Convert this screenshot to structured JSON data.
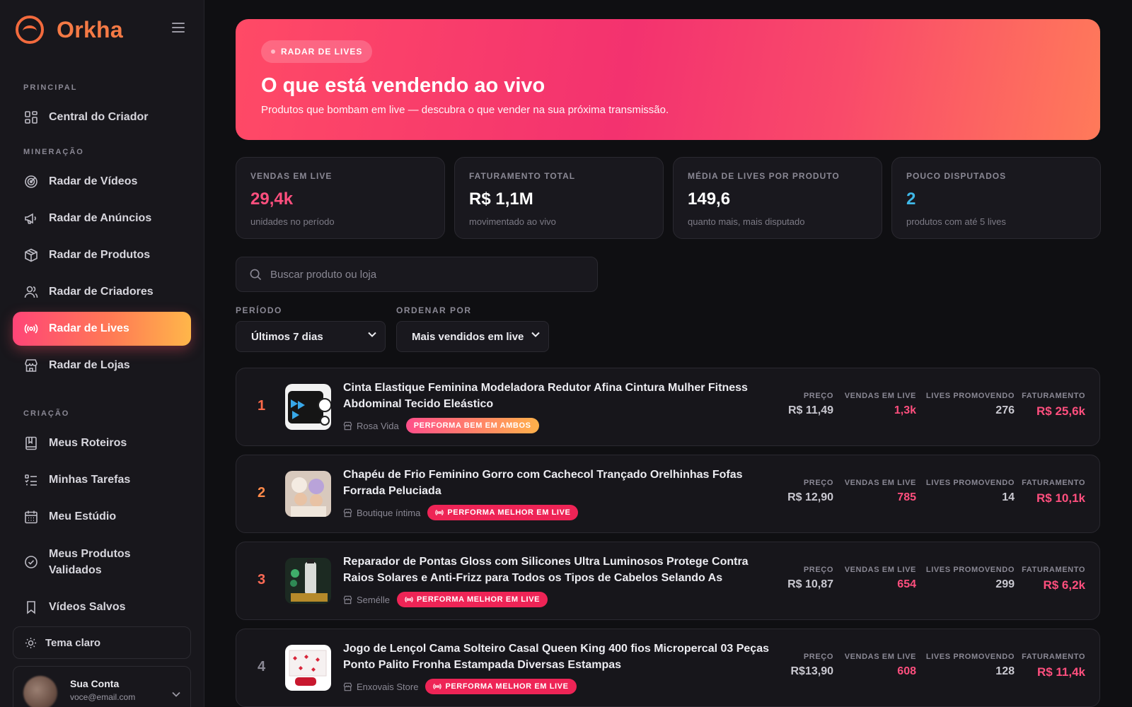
{
  "app": {
    "name": "Orkha"
  },
  "sidebar": {
    "sections": [
      {
        "label": "PRINCIPAL"
      },
      {
        "label": "MINERAÇÃO"
      },
      {
        "label": "CRIAÇÃO"
      }
    ],
    "items": [
      {
        "label": "Central do Criador",
        "icon": "grid-icon"
      },
      {
        "label": "Radar de Vídeos",
        "icon": "radar-icon"
      },
      {
        "label": "Radar de Anúncios",
        "icon": "megaphone-icon"
      },
      {
        "label": "Radar de Produtos",
        "icon": "box-icon"
      },
      {
        "label": "Radar de Criadores",
        "icon": "users-icon"
      },
      {
        "label": "Radar de Lives",
        "icon": "broadcast-icon",
        "active": true
      },
      {
        "label": "Radar de Lojas",
        "icon": "store-icon"
      },
      {
        "label": "Meus Roteiros",
        "icon": "book-icon"
      },
      {
        "label": "Minhas Tarefas",
        "icon": "list-icon"
      },
      {
        "label": "Meu Estúdio",
        "icon": "calendar-icon"
      },
      {
        "label": "Meus Produtos Validados",
        "icon": "check-circle-icon"
      },
      {
        "label": "Vídeos Salvos",
        "icon": "bookmark-icon"
      }
    ],
    "theme_toggle": "Tema claro",
    "account": {
      "name": "Sua Conta",
      "email": "voce@email.com"
    }
  },
  "hero": {
    "badge": "RADAR DE LIVES",
    "title": "O que está vendendo ao vivo",
    "subtitle": "Produtos que bombam em live — descubra o que vender na sua próxima transmissão."
  },
  "stats": [
    {
      "label": "VENDAS EM LIVE",
      "value": "29,4k",
      "note": "unidades no período",
      "color": "#ff4f7e"
    },
    {
      "label": "FATURAMENTO TOTAL",
      "value": "R$ 1,1M",
      "note": "movimentado ao vivo",
      "color": "#ffffff"
    },
    {
      "label": "MÉDIA DE LIVES POR PRODUTO",
      "value": "149,6",
      "note": "quanto mais, mais disputado",
      "color": "#ffffff"
    },
    {
      "label": "POUCO DISPUTADOS",
      "value": "2",
      "note": "produtos com até 5 lives",
      "color": "#3fb8e8"
    }
  ],
  "search": {
    "placeholder": "Buscar produto ou loja",
    "value": ""
  },
  "filters": {
    "period": {
      "label": "PERÍODO",
      "selected": "Últimos 7 dias"
    },
    "order": {
      "label": "ORDENAR POR",
      "selected": "Mais vendidos em live"
    }
  },
  "metric_labels": {
    "price": "PREÇO",
    "sales": "VENDAS EM LIVE",
    "lives": "LIVES PROMOVENDO",
    "revenue": "FATURAMENTO"
  },
  "products": [
    {
      "rank": "1",
      "rank_color": "#ff6a4a",
      "title": "Cinta Elastique Feminina Modeladora Redutor Afina Cintura Mulher Fitness Abdominal Tecido Eleástico",
      "shop": "Rosa Vida",
      "tag": "PERFORMA BEM EM AMBOS",
      "tag_type": "both",
      "price": "R$ 11,49",
      "sales": "1,3k",
      "lives": "276",
      "revenue": "R$ 25,6k"
    },
    {
      "rank": "2",
      "rank_color": "#ff8a4a",
      "title": "Chapéu de Frio Feminino Gorro com Cachecol Trançado Orelhinhas Fofas Forrada Peluciada",
      "shop": "Boutique íntima",
      "tag": "PERFORMA MELHOR EM LIVE",
      "tag_type": "live",
      "price": "R$ 12,90",
      "sales": "785",
      "lives": "14",
      "revenue": "R$ 10,1k"
    },
    {
      "rank": "3",
      "rank_color": "#ff6a55",
      "title": "Reparador de Pontas Gloss com Silicones Ultra Luminosos Protege Contra Raios Solares e Anti-Frizz para Todos os Tipos de Cabelos Selando As Cutículas Brilh...",
      "shop": "Semélle",
      "tag": "PERFORMA MELHOR EM LIVE",
      "tag_type": "live",
      "price": "R$ 10,87",
      "sales": "654",
      "lives": "299",
      "revenue": "R$ 6,2k"
    },
    {
      "rank": "4",
      "rank_color": "#8a8894",
      "title": "Jogo de Lençol Cama Solteiro Casal Queen King 400 fios Micropercal 03 Peças Ponto Palito Fronha Estampada Diversas Estampas",
      "shop": "Enxovais Store",
      "tag": "PERFORMA MELHOR EM LIVE",
      "tag_type": "live",
      "price": "R$13,90",
      "sales": "608",
      "lives": "128",
      "revenue": "R$ 11,4k"
    }
  ],
  "colors": {
    "accent": "#ff4f7e",
    "sales": "#ff4f7e",
    "revenue": "#ff4f7e"
  }
}
